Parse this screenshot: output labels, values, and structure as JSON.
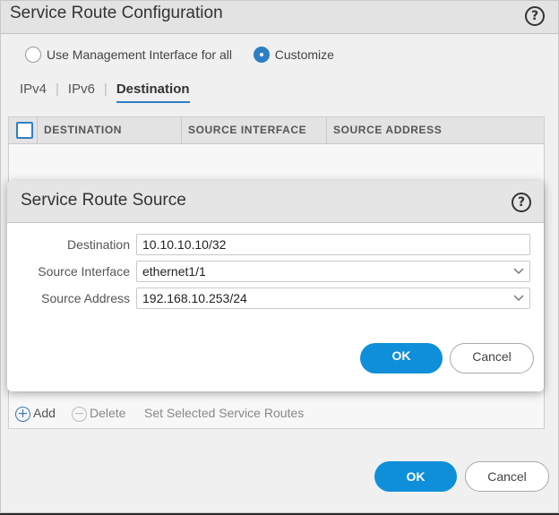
{
  "outer": {
    "title": "Service Route Configuration",
    "help": "?",
    "radios": [
      {
        "label": "Use Management Interface for all",
        "checked": false
      },
      {
        "label": "Customize",
        "checked": true
      }
    ],
    "tabs": [
      "IPv4",
      "IPv6",
      "Destination"
    ],
    "active_tab": "Destination",
    "columns": [
      "DESTINATION",
      "SOURCE INTERFACE",
      "SOURCE ADDRESS"
    ],
    "footer": {
      "add": "Add",
      "delete": "Delete",
      "set_selected": "Set Selected Service Routes"
    },
    "ok": "OK",
    "cancel": "Cancel"
  },
  "modal": {
    "title": "Service Route Source",
    "help": "?",
    "fields": [
      {
        "label": "Destination",
        "value": "10.10.10.10/32",
        "type": "text"
      },
      {
        "label": "Source Interface",
        "value": "ethernet1/1",
        "type": "select"
      },
      {
        "label": "Source Address",
        "value": "192.168.10.253/24",
        "type": "select"
      }
    ],
    "ok": "OK",
    "cancel": "Cancel"
  },
  "colors": {
    "accent": "#2f7ec4",
    "ok_button": "#0f8fd9"
  }
}
